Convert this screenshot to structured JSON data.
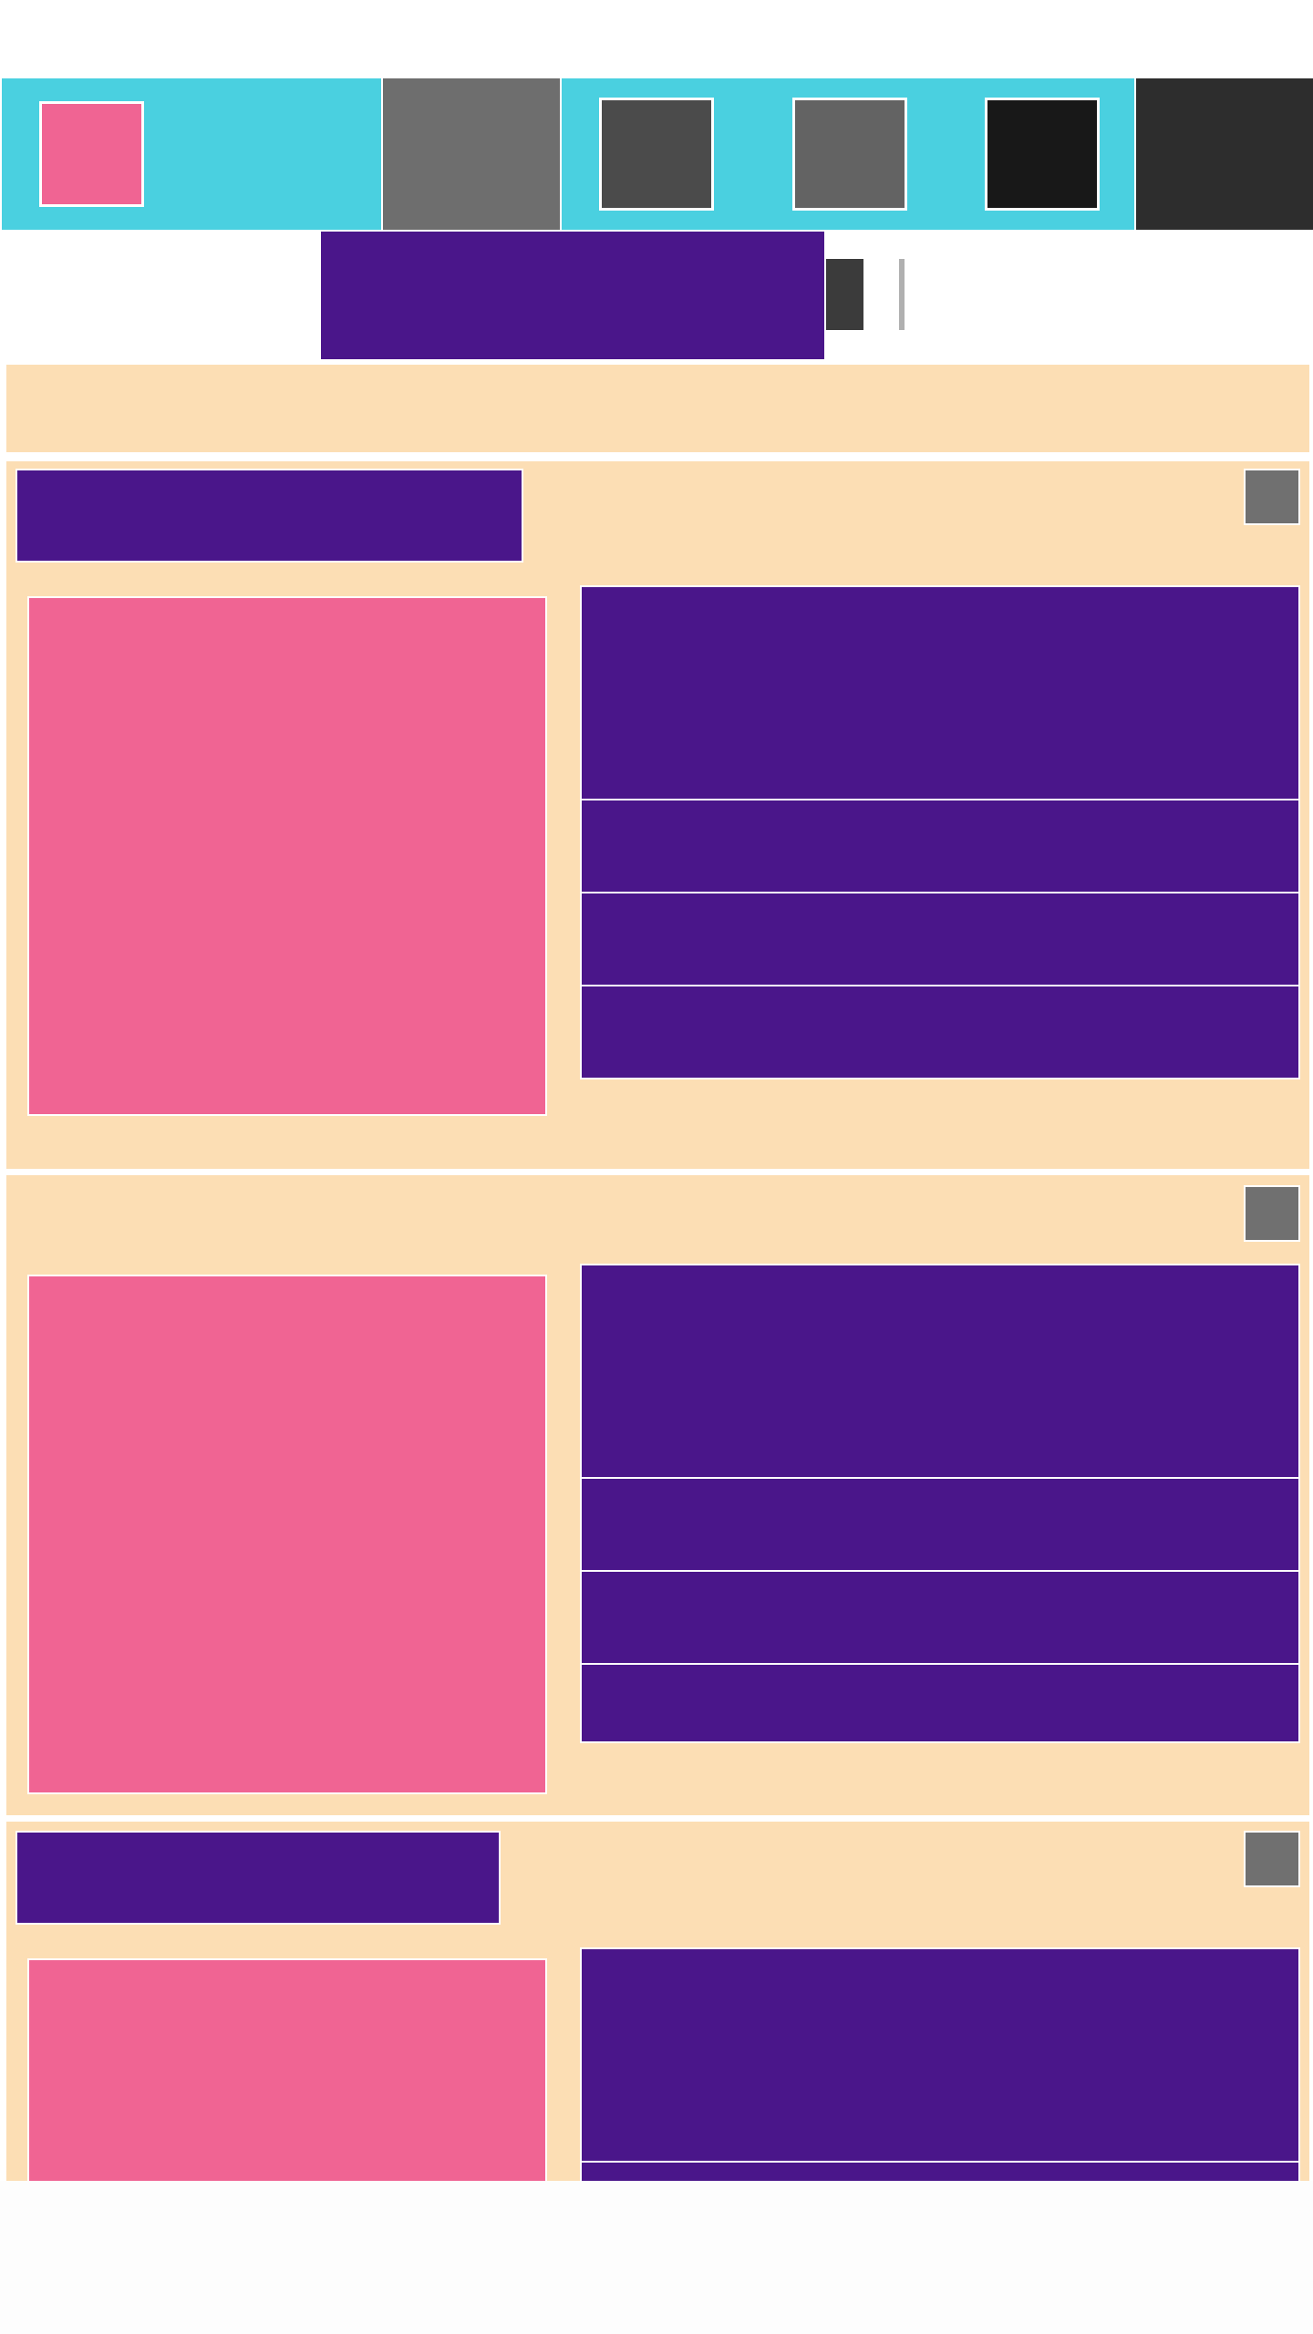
{
  "colors": {
    "accent_cyan": "#4ad0e0",
    "brand_purple": "#4a168a",
    "panel_peach": "#fcdeb4",
    "media_pink": "#f06493"
  },
  "top_bar": {
    "items": [
      {
        "type": "thumbnail",
        "icon": "image-icon"
      },
      {
        "type": "tile"
      },
      {
        "type": "tile"
      },
      {
        "type": "tile"
      },
      {
        "type": "tile"
      },
      {
        "type": "tile"
      }
    ]
  },
  "header": {
    "icon": "menu-icon"
  },
  "cards": [
    {
      "has_title": true,
      "icon": "square-icon",
      "rows": 4
    },
    {
      "has_title": false,
      "icon": "square-icon",
      "rows": 4
    },
    {
      "has_title": true,
      "icon": "square-icon",
      "rows": 2
    }
  ]
}
